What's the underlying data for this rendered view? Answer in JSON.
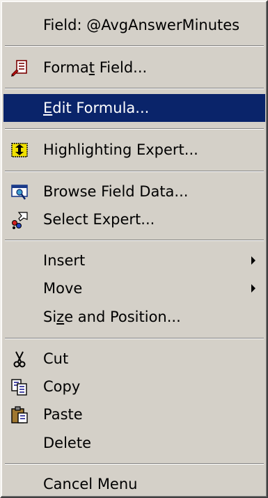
{
  "menu": {
    "header": "Field: @AvgAnswerMinutes",
    "format_field": {
      "before": "Forma",
      "accel": "t",
      "after": " Field..."
    },
    "edit_formula": {
      "before": "",
      "accel": "E",
      "after": "dit Formula..."
    },
    "highlighting_expert": "Highlighting Expert...",
    "browse_field_data": "Browse Field Data...",
    "select_expert": "Select Expert...",
    "insert": "Insert",
    "move": "Move",
    "size_and_position": {
      "before": "Si",
      "accel": "z",
      "after": "e and Position..."
    },
    "cut": "Cut",
    "copy": "Copy",
    "paste": "Paste",
    "delete": "Delete",
    "cancel_menu": "Cancel Menu"
  },
  "icons": {
    "format_field": "format-field-icon",
    "highlighting_expert": "highlighting-expert-icon",
    "browse_field_data": "browse-field-data-icon",
    "select_expert": "select-expert-icon",
    "cut": "scissors-icon",
    "copy": "copy-icon",
    "paste": "paste-icon"
  },
  "colors": {
    "menu_background": "#d4d0c8",
    "selection_background": "#0a246a",
    "selection_text": "#ffffff"
  }
}
